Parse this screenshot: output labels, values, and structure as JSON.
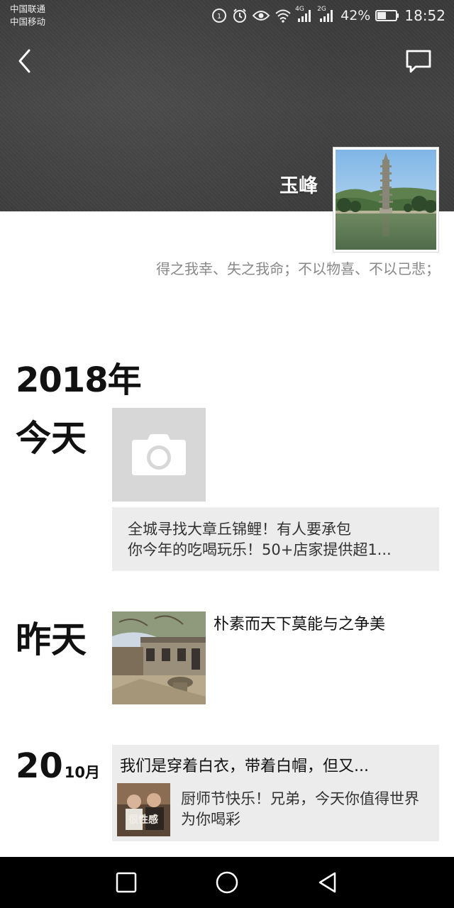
{
  "status_bar": {
    "carrier_1": "中国联通",
    "carrier_2": "中国移动",
    "net_4g": "4G",
    "net_2g": "2G",
    "battery": "42%",
    "time": "18:52"
  },
  "profile": {
    "name": "玉峰",
    "signature": "得之我幸、失之我命；不以物喜、不以己悲；"
  },
  "timeline": {
    "year": "2018年",
    "today": {
      "label": "今天",
      "share_line_1": "全城寻找大章丘锦鲤！有人要承包",
      "share_line_2": "你今年的吃喝玩乐！50+店家提供超1..."
    },
    "yesterday": {
      "label": "昨天",
      "post_text": "朴素而天下莫能与之争美"
    },
    "oct20": {
      "day": "20",
      "month": "10月",
      "article_title": "我们是穿着白衣，带着白帽，但又...",
      "thumb_text": "很性感",
      "article_desc": "厨师节快乐！兄弟，今天你值得世界为你喝彩"
    }
  },
  "colors": {
    "cover_bg": "#3f3f3f",
    "share_bg": "#ececec",
    "camera_tile_bg": "#d7d7d7",
    "nav_bg": "#000000"
  },
  "icons": {
    "back": "chevron-left-icon",
    "message": "message-icon",
    "camera": "camera-icon",
    "nav_recent": "square-icon",
    "nav_home": "circle-icon",
    "nav_back": "triangle-back-icon"
  }
}
